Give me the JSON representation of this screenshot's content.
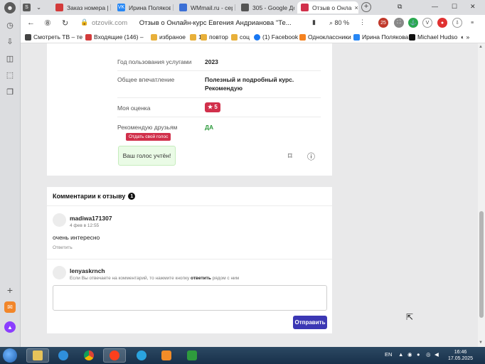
{
  "sidebar": {
    "avatar_letter": "☻",
    "plus": "+",
    "mail_letter": "✉",
    "alice_letter": "▲"
  },
  "tabs": [
    {
      "label": "Заказ номера | S",
      "fav_color": "#d33b3b",
      "fav_text": ""
    },
    {
      "label": "Ирина Полякова",
      "fav_color": "#2787f5",
      "fav_text": "VK"
    },
    {
      "label": "WMmail.ru - серф",
      "fav_color": "#3b6fd6",
      "fav_text": ""
    },
    {
      "label": "305 - Google Док",
      "fav_color": "#555555",
      "fav_text": ""
    },
    {
      "label": "Отзыв о Онла",
      "fav_color": "#d1304b",
      "fav_text": ""
    }
  ],
  "tab_close": "×",
  "new_tab": "+",
  "window_controls": [
    "⧉",
    "—",
    "☐",
    "✕"
  ],
  "address": {
    "domain": "otzovik.com",
    "title": "Отзыв о Онлайн-курс Евгения Андриановa \"Те...",
    "zoom": "80 %",
    "ext_badge": "25"
  },
  "bookmarks": [
    {
      "label": "Смотреть ТВ – те",
      "color": "#444"
    },
    {
      "label": "Входящие (146) –",
      "color": "#d33b3b"
    },
    {
      "label": "избраное",
      "color": "#e8b03a"
    },
    {
      "label": "1",
      "color": "#e8b03a"
    },
    {
      "label": "повтор",
      "color": "#e8b03a"
    },
    {
      "label": "соц",
      "color": "#e8b03a"
    },
    {
      "label": "(1) Facebook",
      "color": "#1877f2"
    },
    {
      "label": "Одноклассники",
      "color": "#f58220"
    },
    {
      "label": "Ирина Полякова",
      "color": "#2787f5"
    },
    {
      "label": "Michael Hudso",
      "color": "#111"
    }
  ],
  "review": {
    "rows": [
      {
        "label": "Год пользования услугами",
        "value": "2023"
      },
      {
        "label": "Общее впечатление",
        "value_line1": "Полезный и подробный курс.",
        "value_line2": "Рекомендую"
      },
      {
        "label": "Моя оценка",
        "value": "★ 5"
      },
      {
        "label": "Рекомендую друзьям",
        "value": "ДА"
      }
    ],
    "tooltip": "Отдать свой голос",
    "voted": "Ваш голос учтён!",
    "bookmark_icon": "⌑",
    "info_icon": "ⓘ"
  },
  "comments": {
    "title": "Комментарии к отзыву",
    "count": "1",
    "items": [
      {
        "user": "madiwa171307",
        "date": "4 фев в 12:55",
        "text": "очень интересно",
        "reply": "Ответить"
      }
    ],
    "form": {
      "user": "lenyaskrnch",
      "hint_before": "Если Вы отвечаете на комментарий, то нажмите кнопку ",
      "hint_bold": "ответить",
      "hint_after": " рядом с ним",
      "send": "Отправить"
    }
  },
  "tray": {
    "lang": "EN",
    "time": "16:46",
    "date": "17.05.2025"
  }
}
